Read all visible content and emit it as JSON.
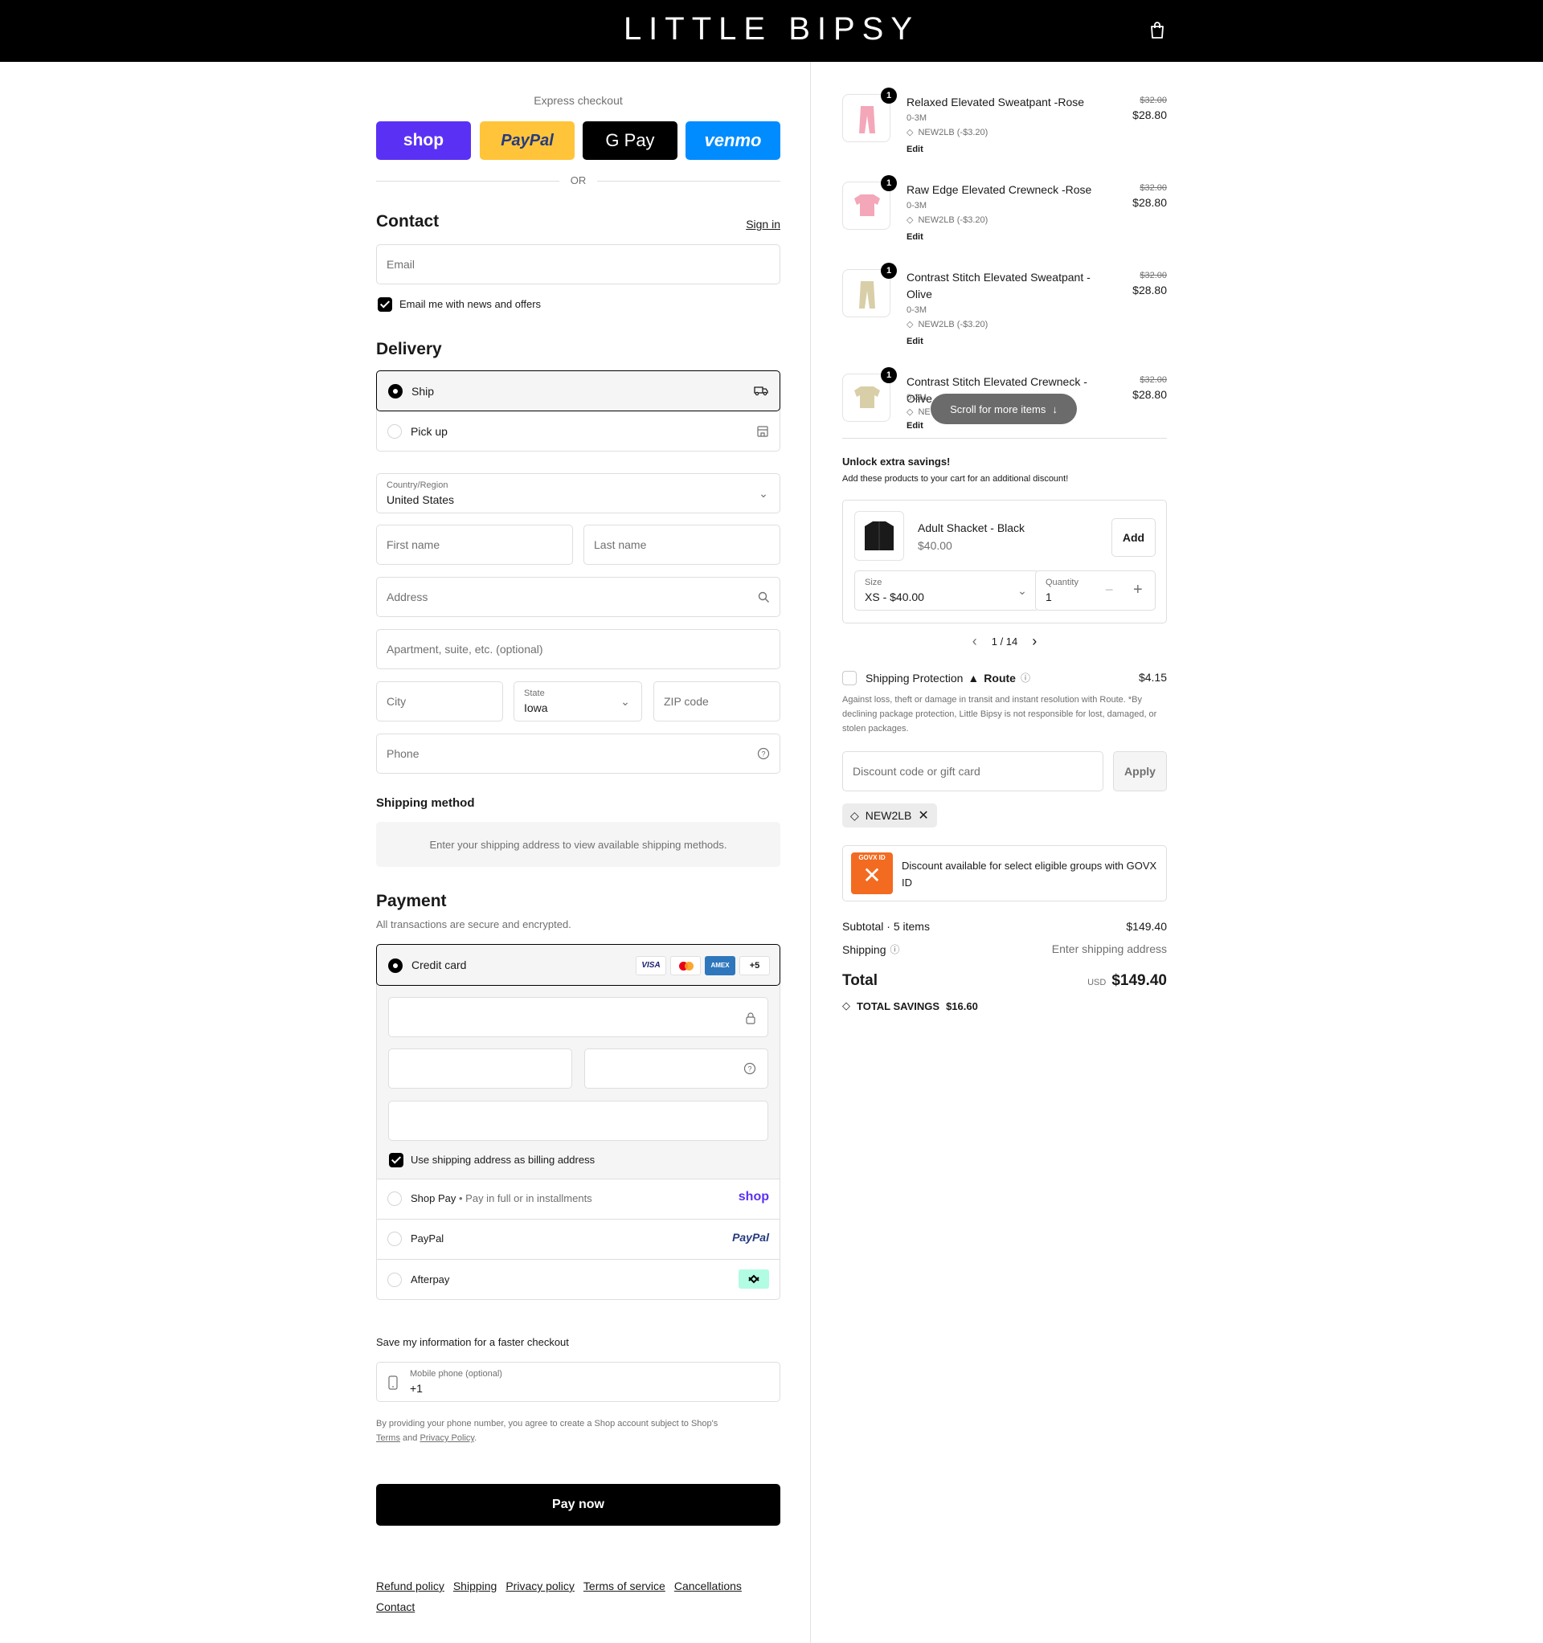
{
  "header": {
    "brand": "LITTLE BIPSY"
  },
  "express": {
    "label": "Express checkout",
    "buttons": [
      {
        "label": "shop",
        "bg": "#5a31f4"
      },
      {
        "label": "PayPal",
        "bg": "#ffc439"
      },
      {
        "label": "G Pay",
        "bg": "#000000"
      },
      {
        "label": "venmo",
        "bg": "#008cff"
      }
    ],
    "or": "OR"
  },
  "contact": {
    "title": "Contact",
    "sign_in": "Sign in",
    "email_placeholder": "Email",
    "news_label": "Email me with news and offers"
  },
  "delivery": {
    "title": "Delivery",
    "ship_label": "Ship",
    "pickup_label": "Pick up",
    "country_label": "Country/Region",
    "country_value": "United States",
    "first_name": "First name",
    "last_name": "Last name",
    "address": "Address",
    "apartment": "Apartment, suite, etc. (optional)",
    "city": "City",
    "state_label": "State",
    "state_value": "Iowa",
    "zip": "ZIP code",
    "phone": "Phone"
  },
  "shipping_method": {
    "title": "Shipping method",
    "message": "Enter your shipping address to view available shipping methods."
  },
  "payment": {
    "title": "Payment",
    "subtitle": "All transactions are secure and encrypted.",
    "credit_card": "Credit card",
    "cards": [
      "VISA",
      "MC",
      "AMEX",
      "+5"
    ],
    "billing_label": "Use shipping address as billing address",
    "shop_pay": "Shop Pay",
    "shop_pay_sub": "Pay in full or in installments",
    "shop_pay_logo": "shop",
    "paypal": "PayPal",
    "paypal_logo": "PayPal",
    "afterpay": "Afterpay"
  },
  "save_info": {
    "title": "Save my information for a faster checkout",
    "phone_label": "Mobile phone (optional)",
    "phone_value": "+1",
    "legal_1": "By providing your phone number, you agree to create a Shop account subject to Shop's",
    "terms": "Terms",
    "and": "and",
    "privacy": "Privacy Policy",
    "period": "."
  },
  "pay_now": "Pay now",
  "footer": [
    "Refund policy",
    "Shipping",
    "Privacy policy",
    "Terms of service",
    "Cancellations",
    "Contact"
  ],
  "cart": {
    "items": [
      {
        "qty": "1",
        "name": "Relaxed Elevated Sweatpant -Rose",
        "variant": "0-3M",
        "discount": "NEW2LB (-$3.20)",
        "edit": "Edit",
        "orig": "$32.00",
        "price": "$28.80",
        "color": "#f4a7b9"
      },
      {
        "qty": "1",
        "name": "Raw Edge Elevated Crewneck -Rose",
        "variant": "0-3M",
        "discount": "NEW2LB (-$3.20)",
        "edit": "Edit",
        "orig": "$32.00",
        "price": "$28.80",
        "color": "#f4a7b9"
      },
      {
        "qty": "1",
        "name": "Contrast Stitch Elevated Sweatpant - Olive",
        "variant": "0-3M",
        "discount": "NEW2LB (-$3.20)",
        "edit": "Edit",
        "orig": "$32.00",
        "price": "$28.80",
        "color": "#d8cfa8"
      },
      {
        "qty": "1",
        "name": "Contrast Stitch Elevated Crewneck - Olive",
        "variant": "0-3M",
        "discount": "NE",
        "edit": "Edit",
        "orig": "$32.00",
        "price": "$28.80",
        "color": "#d8cfa8"
      }
    ],
    "scroll_hint": "Scroll for more items"
  },
  "upsell": {
    "title": "Unlock extra savings!",
    "subtitle": "Add these products to your cart for an additional discount!",
    "product_name": "Adult Shacket - Black",
    "product_price": "$40.00",
    "add": "Add",
    "size_label": "Size",
    "size_value": "XS - $40.00",
    "quantity_label": "Quantity",
    "quantity_value": "1",
    "pager": "1 / 14"
  },
  "protection": {
    "label": "Shipping Protection",
    "brand": "Route",
    "price": "$4.15",
    "desc": "Against loss, theft or damage in transit and instant resolution with Route. *By declining package protection, Little Bipsy is not responsible for lost, damaged, or stolen packages."
  },
  "discount": {
    "placeholder": "Discount code or gift card",
    "apply": "Apply",
    "code": "NEW2LB"
  },
  "govx": {
    "text": "Discount available for select eligible groups with GOVX ID",
    "logo": "GOVX ID"
  },
  "summary": {
    "subtotal_label": "Subtotal · 5 items",
    "subtotal_value": "$149.40",
    "shipping_label": "Shipping",
    "shipping_value": "Enter shipping address",
    "total_label": "Total",
    "currency": "USD",
    "total_value": "$149.40",
    "savings_label": "TOTAL SAVINGS",
    "savings_value": "$16.60"
  }
}
